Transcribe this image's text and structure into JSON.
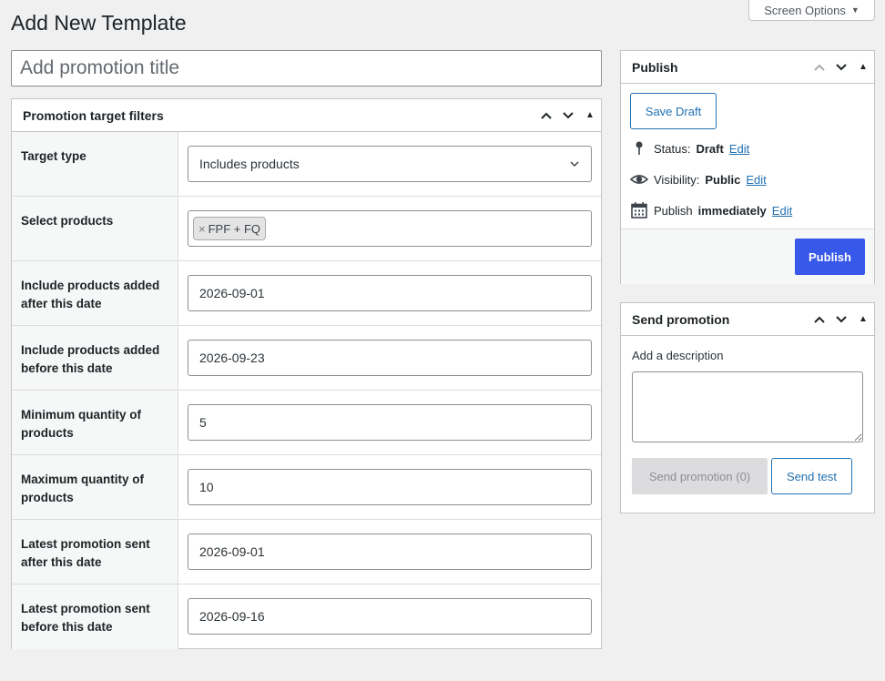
{
  "page": {
    "title": "Add New Template",
    "screen_options": "Screen Options"
  },
  "title_field": {
    "placeholder": "Add promotion title",
    "value": ""
  },
  "filters": {
    "heading": "Promotion target filters",
    "target_type": {
      "label": "Target type",
      "value": "Includes products"
    },
    "select_products": {
      "label": "Select products",
      "token_remove": "×",
      "token": "FPF + FQ"
    },
    "after_date": {
      "label": "Include products added after this date",
      "value": "2026-09-01"
    },
    "before_date": {
      "label": "Include products added before this date",
      "value": "2026-09-23"
    },
    "min_qty": {
      "label": "Minimum quantity of products",
      "value": "5"
    },
    "max_qty": {
      "label": "Maximum quantity of products",
      "value": "10"
    },
    "sent_after": {
      "label": "Latest promotion sent after this date",
      "value": "2026-09-01"
    },
    "sent_before": {
      "label": "Latest promotion sent before this date",
      "value": "2026-09-16"
    }
  },
  "publish": {
    "heading": "Publish",
    "save_draft": "Save Draft",
    "status_label": "Status:",
    "status_value": "Draft",
    "visibility_label": "Visibility:",
    "visibility_value": "Public",
    "publish_label": "Publish",
    "publish_value": "immediately",
    "edit": "Edit",
    "publish_button": "Publish"
  },
  "send_promotion": {
    "heading": "Send promotion",
    "description_label": "Add a description",
    "description_value": "",
    "send_button": "Send promotion (0)",
    "test_button": "Send test"
  },
  "colors": {
    "primary": "#3858e9",
    "link": "#2271b1",
    "background": "#f0f0f1"
  },
  "icons": [
    "chevron-up-icon",
    "chevron-down-icon",
    "toggle-arrow-icon",
    "pin-icon",
    "eye-icon",
    "calendar-icon",
    "chevron-down-icon"
  ]
}
